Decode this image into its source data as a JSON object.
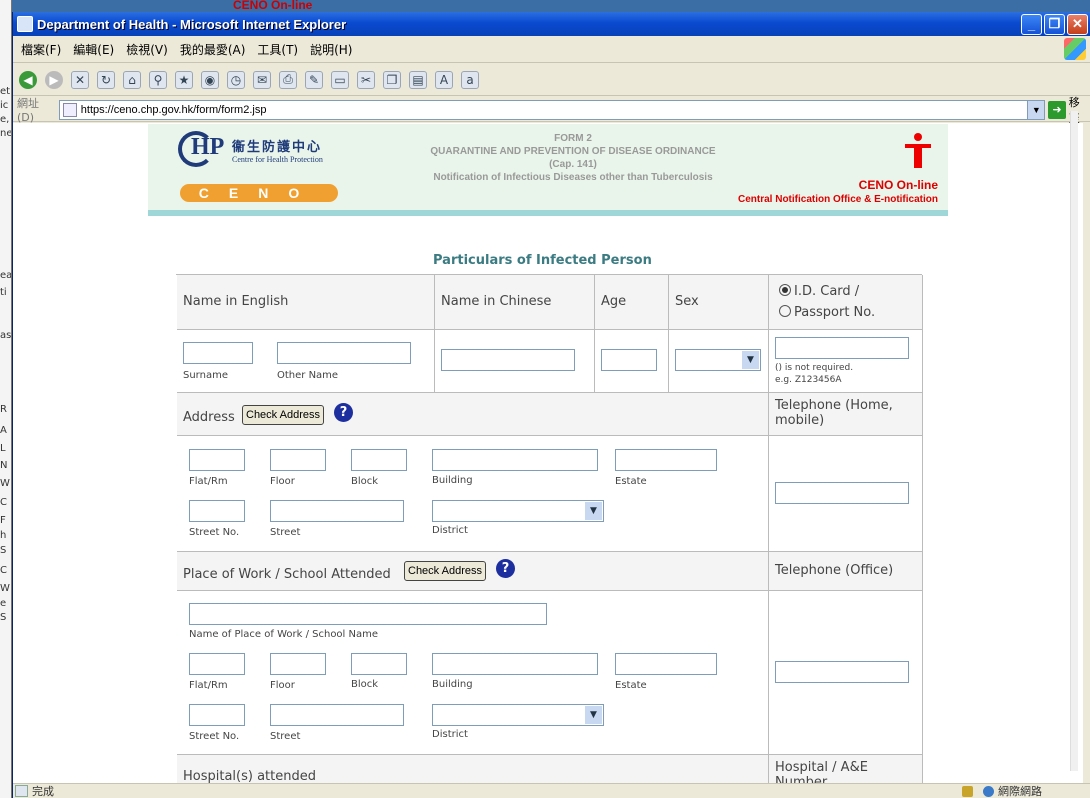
{
  "background": {
    "top_text": "CENO On-line",
    "left_frags": [
      "et",
      "ic",
      "e,",
      "ne",
      "ea",
      "ti",
      "as",
      "R",
      "A",
      "L",
      "N",
      "W",
      "C",
      "F",
      "h",
      "S",
      "C",
      "W",
      "e",
      "S"
    ]
  },
  "window": {
    "title": "Department of Health - Microsoft Internet Explorer",
    "menu": [
      "檔案(F)",
      "編輯(E)",
      "檢視(V)",
      "我的最愛(A)",
      "工具(T)",
      "說明(H)"
    ],
    "address_label": "網址(D)",
    "url": "https://ceno.chp.gov.hk/form/form2.jsp",
    "go_label": "移至",
    "status": "完成",
    "zone": "網際網路"
  },
  "banner": {
    "hp": "HP",
    "org_cn": "衞生防護中心",
    "org_en": "Centre for Health Protection",
    "ceno": "CENO",
    "form_no": "FORM 2",
    "ordinance": "QUARANTINE AND PREVENTION OF DISEASE ORDINANCE",
    "cap": "(Cap. 141)",
    "notification": "Notification of Infectious Diseases other than Tuberculosis",
    "ceno_online": "CENO On-line",
    "cno": "Central Notification Office & E-notification"
  },
  "section_title": "Particulars of Infected Person",
  "form": {
    "name_en": "Name in English",
    "name_cn": "Name in Chinese",
    "age": "Age",
    "sex": "Sex",
    "id_card": "I.D. Card /",
    "passport": "Passport No.",
    "surname": "Surname",
    "other_name": "Other Name",
    "id_note_1": "() is not required.",
    "id_note_2": "e.g. Z123456A",
    "address": "Address",
    "check_address": "Check Address",
    "telephone_home": "Telephone (Home, mobile)",
    "flat_rm": "Flat/Rm",
    "floor": "Floor",
    "block": "Block",
    "building": "Building",
    "estate": "Estate",
    "street_no": "Street No.",
    "street": "Street",
    "district": "District",
    "place_of_work": "Place of Work / School Attended",
    "telephone_office": "Telephone (Office)",
    "work_name": "Name of Place of Work / School Name",
    "hospital": "Hospital(s) attended",
    "hospital_no": "Hospital / A&E Number"
  }
}
